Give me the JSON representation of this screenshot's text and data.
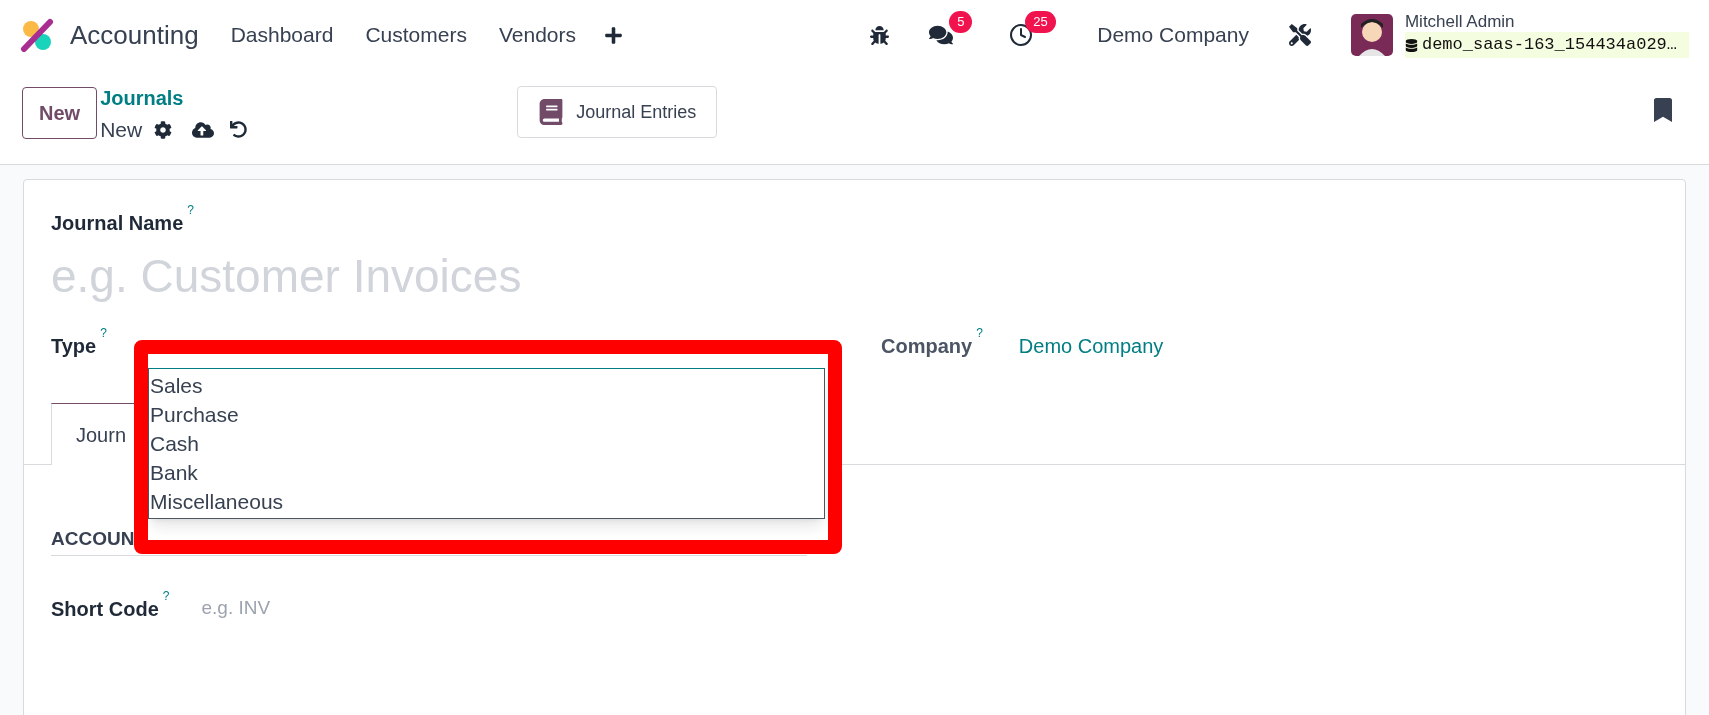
{
  "navbar": {
    "app_name": "Accounting",
    "menu": [
      "Dashboard",
      "Customers",
      "Vendors"
    ],
    "messages_count": "5",
    "activities_count": "25",
    "company": "Demo Company",
    "user_name": "Mitchell Admin",
    "database": "demo_saas-163_154434a029…"
  },
  "control_panel": {
    "new_button": "New",
    "breadcrumb_parent": "Journals",
    "breadcrumb_current": "New",
    "smart_button": "Journal Entries"
  },
  "form": {
    "journal_name": {
      "label": "Journal Name",
      "help": "?",
      "placeholder": "e.g. Customer Invoices"
    },
    "type": {
      "label": "Type",
      "help": "?"
    },
    "company": {
      "label": "Company",
      "help": "?",
      "value": "Demo Company"
    },
    "tabs": [
      {
        "label": "Journ",
        "selected": true
      }
    ],
    "section_heading": "ACCOUN",
    "short_code": {
      "label": "Short Code",
      "help": "?",
      "placeholder": "e.g. INV"
    }
  },
  "type_dropdown": {
    "options": [
      "Sales",
      "Purchase",
      "Cash",
      "Bank",
      "Miscellaneous"
    ]
  }
}
